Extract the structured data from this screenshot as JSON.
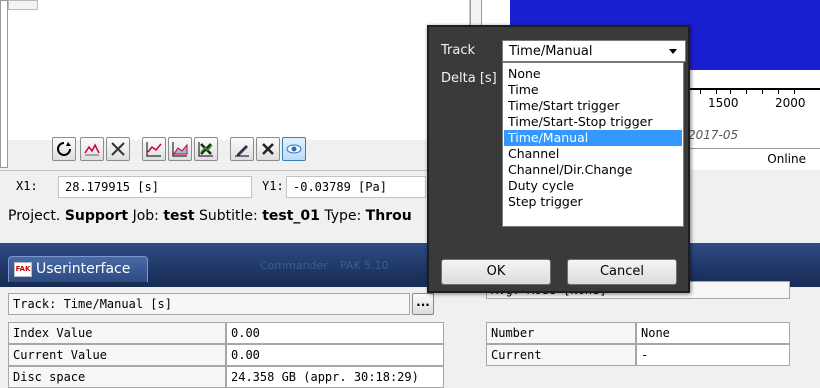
{
  "cursor": {
    "x_label": "X1:",
    "x_value": "28.179915 [s]",
    "y_label": "Y1:",
    "y_value": "-0.03789 [Pa]"
  },
  "project_line": {
    "p1": "Project. ",
    "project": "Support",
    "p2": " Job: ",
    "job": "test",
    "p3": " Subtitle: ",
    "subtitle": "test_01",
    "p4": " Type: ",
    "type": "Throu"
  },
  "spectrogram": {
    "tick_1500": "1500",
    "tick_2000": "2000",
    "date": "2017-05",
    "status": "Online"
  },
  "userinterface": {
    "tab_title": "Userinterface",
    "fak_logo": "FAK",
    "track_label": "Track: Time/Manual [s]",
    "more_button": "...",
    "avg_mode": "Avg. Mode [None]",
    "rows": [
      {
        "key": "Index Value",
        "value": "0.00"
      },
      {
        "key": "Current Value",
        "value": "0.00"
      },
      {
        "key": "Disc space",
        "value": "24.358 GB (appr. 30:18:29)"
      }
    ],
    "right_rows": [
      {
        "key": "Number",
        "value": "None"
      },
      {
        "key": "Current",
        "value": "-"
      }
    ]
  },
  "dialog": {
    "track_label": "Track",
    "delta_label": "Delta [s]",
    "selected": "Time/Manual",
    "options": [
      "None",
      "Time",
      "Time/Start trigger",
      "Time/Start-Stop trigger",
      "Time/Manual",
      "Channel",
      "Channel/Dir.Change",
      "Duty cycle",
      "Step trigger"
    ],
    "ok_label": "OK",
    "cancel_label": "Cancel"
  },
  "colors": {
    "spectrogram_blue": "#1a1fd0",
    "selection": "#3399ff",
    "dialog_bg": "#3a3a3a",
    "header_blue": "#1f3766"
  }
}
